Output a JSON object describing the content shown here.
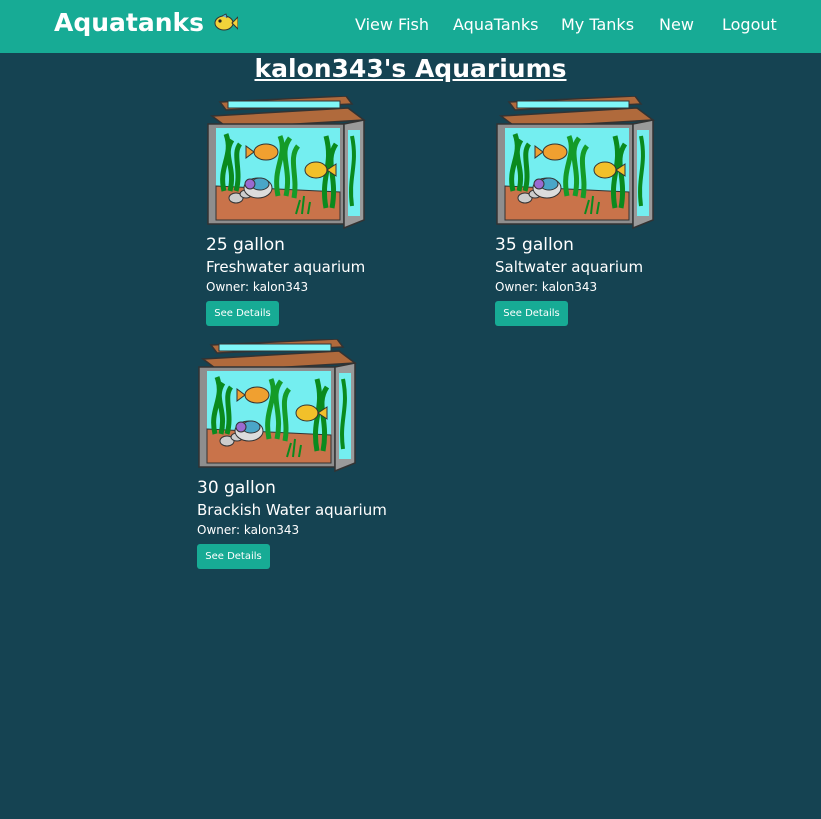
{
  "navbar": {
    "brand": "Aquatanks",
    "links": [
      "View Fish",
      "AquaTanks",
      "My Tanks",
      "New",
      "Logout"
    ]
  },
  "page": {
    "title": "kalon343's Aquariums"
  },
  "tanks": [
    {
      "gallons": "25 gallon",
      "type": "Freshwater aquarium",
      "owner": "Owner: kalon343",
      "button": "See Details"
    },
    {
      "gallons": "35 gallon",
      "type": "Saltwater aquarium",
      "owner": "Owner: kalon343",
      "button": "See Details"
    },
    {
      "gallons": "30 gallon",
      "type": "Brackish Water aquarium",
      "owner": "Owner: kalon343",
      "button": "See Details"
    }
  ],
  "colors": {
    "navbar": "#17ab95",
    "background": "#154352",
    "button": "#17ab95"
  }
}
